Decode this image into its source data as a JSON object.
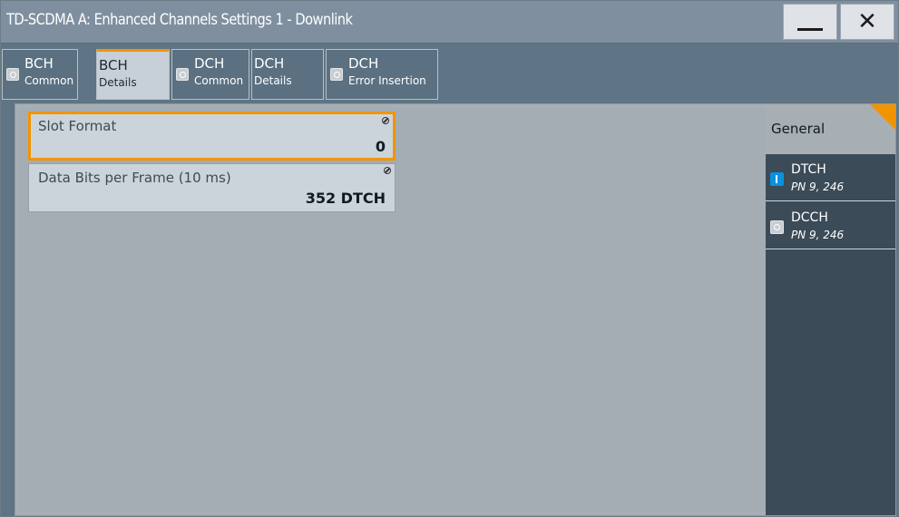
{
  "window": {
    "title": "TD-SCDMA A: Enhanced Channels Settings 1 - Downlink",
    "minimize_icon": "minimize-icon",
    "close_icon": "close-icon"
  },
  "tabs": [
    {
      "top": "BCH",
      "bottom": "Common",
      "checkbox": true,
      "active": false
    },
    {
      "top": "BCH",
      "bottom": "Details",
      "checkbox": false,
      "active": true
    },
    {
      "top": "DCH",
      "bottom": "Common",
      "checkbox": true,
      "active": false
    },
    {
      "top": "DCH",
      "bottom": "Details",
      "checkbox": false,
      "active": false
    },
    {
      "top": "DCH",
      "bottom": "Error Insertion",
      "checkbox": true,
      "active": false
    }
  ],
  "fields": {
    "slot_format": {
      "label": "Slot Format",
      "value": "0"
    },
    "data_bits": {
      "label": "Data Bits per Frame (10 ms)",
      "value": "352 DTCH"
    }
  },
  "sidebar": {
    "heading": "General",
    "items": [
      {
        "name": "DTCH",
        "sub": "PN 9, 246",
        "state": "on"
      },
      {
        "name": "DCCH",
        "sub": "PN 9, 246",
        "state": "off"
      }
    ]
  },
  "colors": {
    "accent": "#f29400",
    "toggle_on": "#0a90e0",
    "titlebar": "#7f8fa0",
    "sidepanel": "#3b4b57"
  }
}
